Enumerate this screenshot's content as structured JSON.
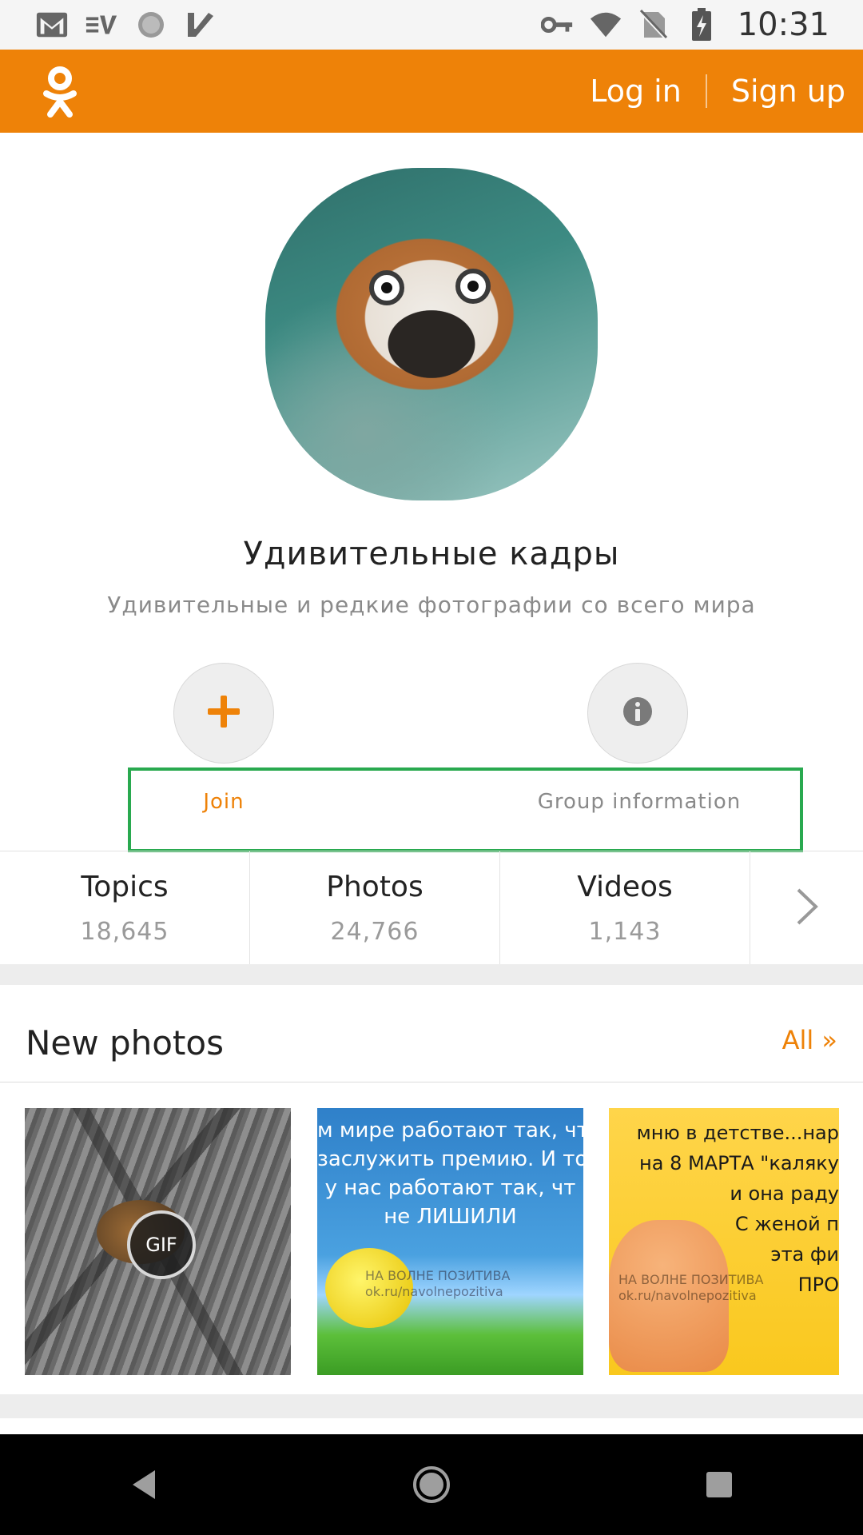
{
  "status_bar": {
    "time": "10:31",
    "left_icons": [
      "gmail-icon",
      "ev-icon",
      "sync-icon",
      "check-icon"
    ],
    "right_icons": [
      "key-icon",
      "wifi-icon",
      "no-sim-icon",
      "battery-icon"
    ]
  },
  "header": {
    "brand": "ok-logo-icon",
    "login_label": "Log in",
    "signup_label": "Sign up",
    "brand_color": "#ee8208"
  },
  "group": {
    "title": "Удивительные кадры",
    "subtitle": "Удивительные и редкие фотографии со всего мира"
  },
  "actions": {
    "join_label": "Join",
    "info_label": "Group information"
  },
  "stats": [
    {
      "name": "Topics",
      "count": "18,645"
    },
    {
      "name": "Photos",
      "count": "24,766"
    },
    {
      "name": "Videos",
      "count": "1,143"
    }
  ],
  "new_photos": {
    "title": "New photos",
    "all_label": "All »",
    "items": [
      {
        "badge": "GIF"
      },
      {
        "text": "м мире работают так, чт\nзаслужить премию. И то\nу нас работают так, чт\nне ЛИШИЛИ",
        "watermark": "НА ВОЛНЕ ПОЗИТИВА\nok.ru/navolnepozitiva"
      },
      {
        "text": "мню в детстве...нар\nна 8 МАРТА \"каляку\nи она раду\nС женой п\nэта фи\nПРО",
        "watermark": "НА ВОЛНЕ ПОЗИТИВА\nok.ru/navolnepozitiva"
      }
    ]
  },
  "nav": [
    "back-icon",
    "home-icon",
    "recents-icon"
  ]
}
